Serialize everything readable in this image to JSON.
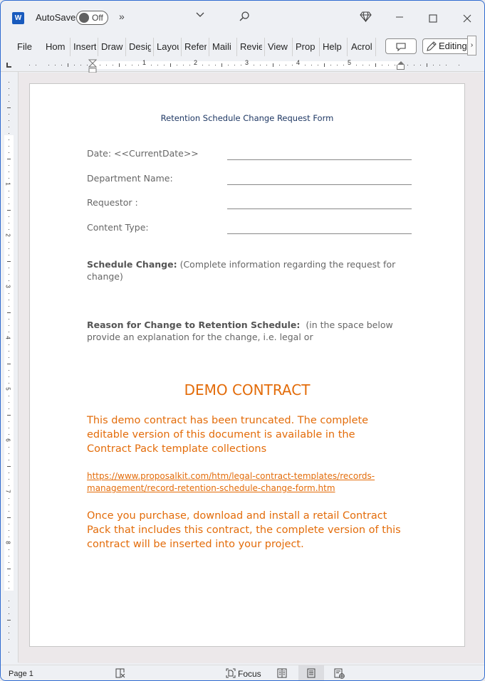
{
  "titlebar": {
    "app_icon": "word-logo",
    "app_letter": "W",
    "autosave_label": "AutoSave",
    "autosave_state": "Off",
    "more_commands": "»",
    "icons": [
      "chevron-down-icon",
      "search-icon",
      "diamond-icon",
      "minimize-icon",
      "maximize-icon",
      "close-icon"
    ]
  },
  "ribbon": {
    "tabs": [
      "File",
      "Home",
      "Insert",
      "Draw",
      "Design",
      "Layout",
      "References",
      "Mailings",
      "Review",
      "View",
      "Properties",
      "Help",
      "Acrobat"
    ],
    "tabs_visible": [
      "File",
      "Hom",
      "Insert",
      "Draw",
      "Desig",
      "Layou",
      "Refer",
      "Maili",
      "Revie",
      "View",
      "Prop",
      "Help",
      "Acrol"
    ],
    "comment_icon": "comment-icon",
    "editing_label": "Editing",
    "scroll_label": "›"
  },
  "ruler": {
    "numbers": [
      "1",
      "2",
      "3",
      "4",
      "5"
    ],
    "vertical_numbers": [
      "1",
      "2",
      "3",
      "4",
      "5",
      "6",
      "7",
      "8"
    ]
  },
  "document": {
    "title": "Retention Schedule Change Request Form",
    "fields": [
      {
        "label": "Date: <<CurrentDate>>"
      },
      {
        "label": "Department Name:"
      },
      {
        "label": "Requestor :"
      },
      {
        "label": "Content Type:"
      }
    ],
    "schedule_change": {
      "bold": "Schedule Change:",
      "text": " (Complete information regarding the request for change)"
    },
    "reason": {
      "bold": "Reason for Change to Retention Schedule:",
      "text": "  (in the space below provide an explanation for the change, i.e. legal or"
    },
    "demo_heading": "DEMO CONTRACT",
    "demo_para1": "This demo contract has been truncated. The complete editable version of this document is available in the Contract Pack template collections",
    "demo_link": "https://www.proposalkit.com/htm/legal-contract-templates/records-management/record-retention-schedule-change-form.htm",
    "demo_para2": "Once you purchase, download and install a retail Contract Pack that includes this contract, the complete version of this contract will be inserted into your project.",
    "accent_color": "#e36c0a",
    "title_color": "#1f3864"
  },
  "statusbar": {
    "page": "Page 1",
    "focus_label": "Focus",
    "icons": [
      "accessibility-icon",
      "focus-icon",
      "read-mode-icon",
      "print-layout-icon",
      "web-layout-icon"
    ],
    "active_view": "print-layout"
  }
}
